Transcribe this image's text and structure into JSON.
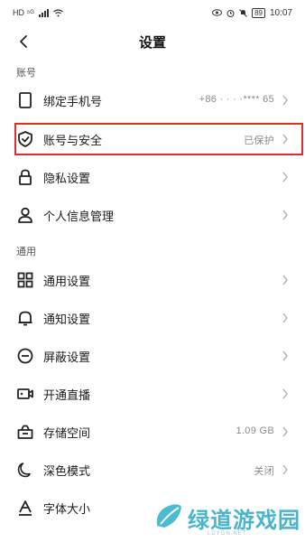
{
  "status_bar": {
    "left": "HD ⁵ᴳ",
    "battery": "89",
    "time": "10:07"
  },
  "header": {
    "title": "设置",
    "back_icon": "chevron-left-icon"
  },
  "sections": [
    {
      "header": "账号",
      "items": [
        {
          "label": "绑定手机号",
          "value": "+86 · · · ·**** 65",
          "icon": "phone-icon"
        },
        {
          "label": "账号与安全",
          "value": "已保护",
          "icon": "shield-icon"
        },
        {
          "label": "隐私设置",
          "value": "",
          "icon": "lock-icon"
        },
        {
          "label": "个人信息管理",
          "value": "",
          "icon": "person-icon"
        }
      ]
    },
    {
      "header": "通用",
      "items": [
        {
          "label": "通用设置",
          "value": "",
          "icon": "grid-icon"
        },
        {
          "label": "通知设置",
          "value": "",
          "icon": "bell-icon"
        },
        {
          "label": "屏蔽设置",
          "value": "",
          "icon": "block-icon"
        },
        {
          "label": "开通直播",
          "value": "",
          "icon": "live-camera-icon"
        },
        {
          "label": "存储空间",
          "value": "1.09 GB",
          "icon": "storage-icon"
        },
        {
          "label": "深色模式",
          "value": "关闭",
          "icon": "moon-icon"
        },
        {
          "label": "字体大小",
          "value": "",
          "icon": "font-size-icon"
        }
      ]
    }
  ],
  "watermark": {
    "text": "绿道游戏园",
    "sub": "LDYGN.NET"
  },
  "colors": {
    "highlight": "#d9302c",
    "watermark": "#2aa8c6"
  }
}
